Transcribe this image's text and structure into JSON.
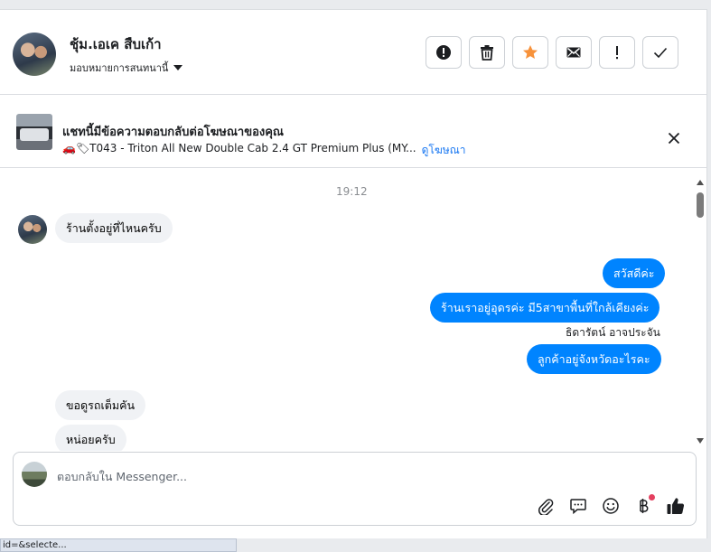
{
  "header": {
    "name": "ชุ้ม.เอเค สืบเก้า",
    "assign_label": "มอบหมายการสนทนานี้",
    "actions": [
      {
        "name": "spam",
        "icon": "exclamation-circle-icon"
      },
      {
        "name": "delete",
        "icon": "trash-icon"
      },
      {
        "name": "star",
        "icon": "star-icon",
        "color": "#f7923b"
      },
      {
        "name": "mark-unread",
        "icon": "envelope-icon"
      },
      {
        "name": "follow-up",
        "icon": "exclamation-icon"
      },
      {
        "name": "done",
        "icon": "check-icon"
      }
    ]
  },
  "ad": {
    "title": "แชทนี้มีข้อความตอบกลับต่อโฆษณาของคุณ",
    "subtitle": "🚗🏷T043 - Triton All New Double Cab 2.4 GT Premium Plus (MY...",
    "link": "ดูโฆษณา"
  },
  "chat": {
    "timestamp": "19:12",
    "messages": [
      {
        "dir": "in",
        "text": "ร้านตั้งอยู่ที่ไหนครับ"
      },
      {
        "dir": "out",
        "text": "สวัสดีค่ะ"
      },
      {
        "dir": "out",
        "text": "ร้านเราอยู่อุดรค่ะ มี5สาขาพื้นที่ใกล้เคียงค่ะ"
      },
      {
        "dir": "sender",
        "text": "ธิดารัตน์ อาจประจัน"
      },
      {
        "dir": "out",
        "text": "ลูกค้าอยู่จังหวัดอะไรคะ"
      },
      {
        "dir": "in",
        "text": "ขอดูรถเต็มคัน"
      },
      {
        "dir": "in",
        "text": "หน่อยครับ"
      }
    ]
  },
  "composer": {
    "placeholder": "ตอบกลับใน Messenger...",
    "tools": [
      "paperclip-icon",
      "chat-bubble-icon",
      "smiley-icon",
      "baht-icon",
      "thumbs-up-icon"
    ]
  },
  "statusbar": {
    "text": "id=&selecte..."
  },
  "colors": {
    "accent": "#0084ff",
    "link": "#1877f2",
    "star": "#f7923b",
    "notification": "#e4405f"
  }
}
